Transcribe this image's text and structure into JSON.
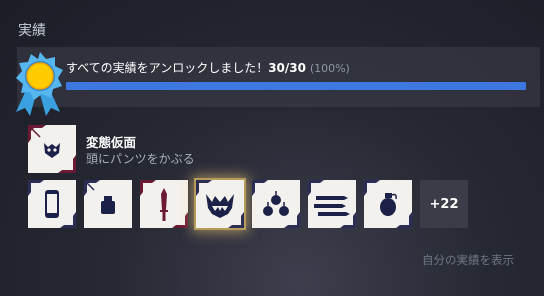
{
  "section": {
    "title": "実績"
  },
  "progress": {
    "message": "すべての実績をアンロックしました！",
    "count": "30/30",
    "percent_label": "(100%)",
    "fraction": 1.0,
    "bar_color": "#3f77e0"
  },
  "featured": {
    "name": "変態仮面",
    "description": "頭にパンツをかぶる",
    "icon": "mask-icon"
  },
  "badges": [
    {
      "icon": "phone-icon",
      "selected": false
    },
    {
      "icon": "bottle-icon",
      "selected": false
    },
    {
      "icon": "knife-icon",
      "selected": false
    },
    {
      "icon": "fanged-mouth-icon",
      "selected": true
    },
    {
      "icon": "bomb-cluster-icon",
      "selected": false
    },
    {
      "icon": "blades-icon",
      "selected": false
    },
    {
      "icon": "grenade-icon",
      "selected": false
    }
  ],
  "more_badges_label": "+22",
  "view_link": "自分の実績を表示"
}
